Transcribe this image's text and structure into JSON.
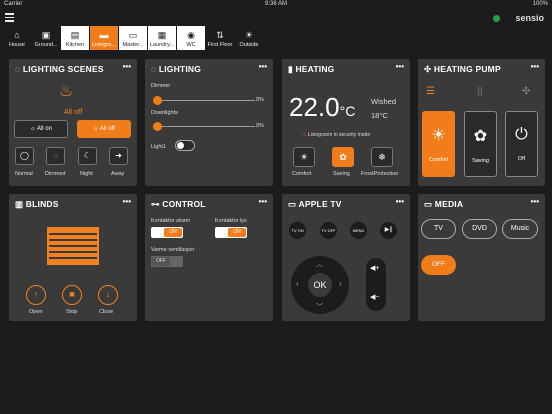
{
  "status": {
    "carrier": "Carrier",
    "time": "9:36 AM",
    "battery": "100%"
  },
  "brand": {
    "logo": "sensio"
  },
  "rooms": [
    {
      "label": "House",
      "icon": "⌂"
    },
    {
      "label": "Ground...",
      "icon": "▣"
    },
    {
      "label": "Kitchen",
      "icon": "▤"
    },
    {
      "label": "Livingro...",
      "icon": "▬"
    },
    {
      "label": "Master...",
      "icon": "▭"
    },
    {
      "label": "Laundry...",
      "icon": "▦"
    },
    {
      "label": "WC",
      "icon": "◉"
    },
    {
      "label": "First Floor",
      "icon": "⇅"
    },
    {
      "label": "Outside",
      "icon": "☀"
    }
  ],
  "lighting_scenes": {
    "title": "LIGHTING SCENES",
    "state": "All off",
    "all_on": "All on",
    "all_off": "All off",
    "scenes": [
      "Normal",
      "Dimmed",
      "Night",
      "Away"
    ]
  },
  "lighting": {
    "title": "LIGHTING",
    "dimmer_label": "Dimmer",
    "dimmer_value": "0%",
    "downlights_label": "Downlights",
    "downlights_value": "0%",
    "light1_label": "Light1",
    "dimmer_level": 0,
    "downlights_level": 0
  },
  "heating": {
    "title": "HEATING",
    "current": "22.0",
    "unit": "°C",
    "wished_label": "Wished",
    "wished_value": "18°C",
    "alert": "Livingroom in security mode",
    "modes": [
      "Comfort",
      "Saving",
      "FrostProtection"
    ]
  },
  "heating_pump": {
    "title": "HEATING PUMP",
    "modes": [
      "Comfort",
      "Saving",
      "Off"
    ]
  },
  "blinds": {
    "title": "BLINDS",
    "buttons": [
      "Open",
      "Stop",
      "Close"
    ]
  },
  "control": {
    "title": "CONTROL",
    "kontaktor_strom": "Kontaktor strøm",
    "kontaktor_strom_state": "ON",
    "kontaktor_lys": "Kontaktor lys",
    "kontaktor_lys_state": "ON",
    "varme": "Varme ventilasjon",
    "varme_state": "OFF"
  },
  "apple_tv": {
    "title": "APPLE TV",
    "tv_on": "TV ON",
    "tv_off": "TV OFF",
    "menu": "MENU",
    "ok": "OK"
  },
  "media": {
    "title": "MEDIA",
    "tv": "TV",
    "dvd": "DVD",
    "music": "Music",
    "off": "OFF"
  },
  "more": "•••"
}
